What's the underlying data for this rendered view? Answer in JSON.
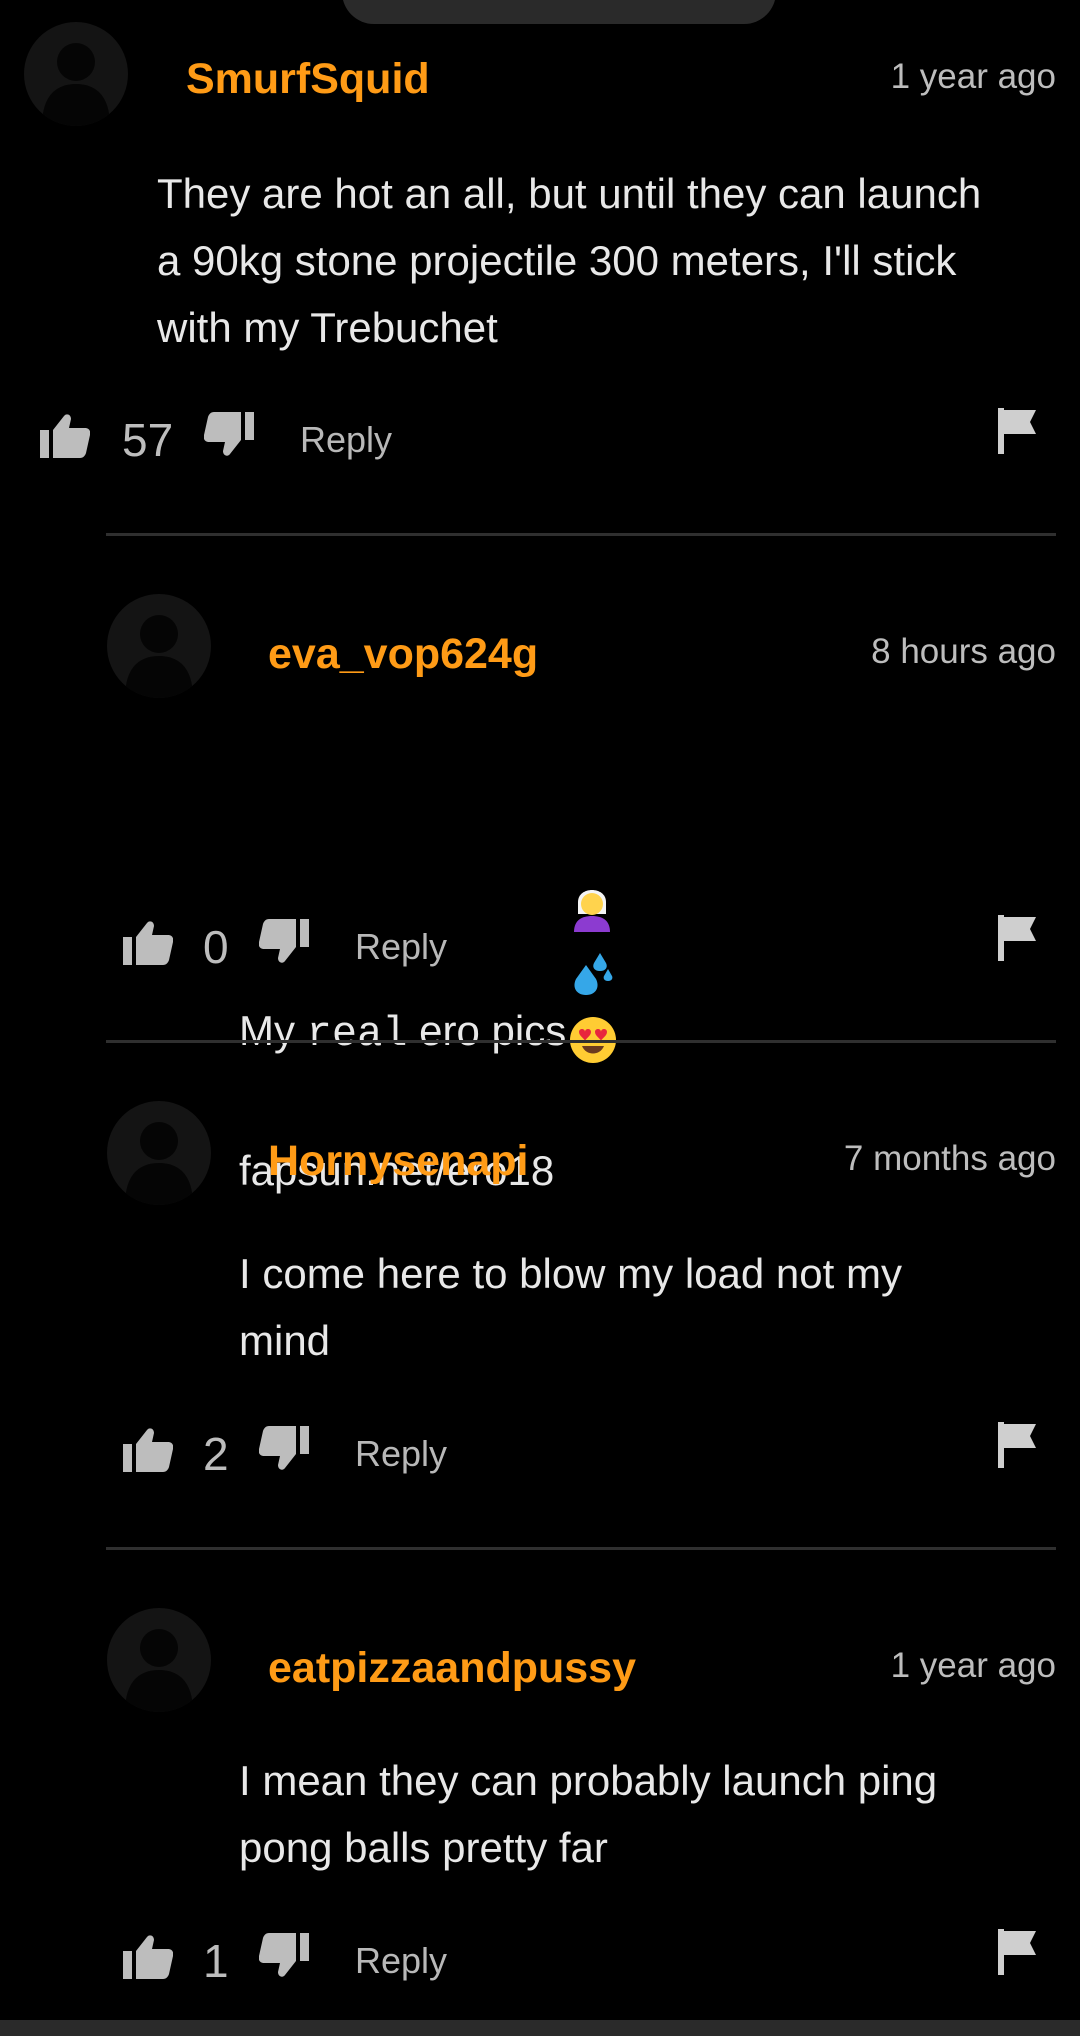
{
  "comments": [
    {
      "username": "SmurfSquid",
      "timestamp": "1 year ago",
      "text": "They are hot an all, but until they can launch\na 90kg stone projectile 300 meters, I'll stick\nwith my Trebuchet",
      "likes": "57",
      "reply_label": "Reply"
    },
    {
      "username": "eva_vop624g",
      "timestamp": "8 hours ago",
      "text_prefix": "My ",
      "text_mono": "real",
      "text_suffix": " ero pics",
      "text_line2": "fapsun.net/ero18",
      "emojis": [
        "woman-white-hair-emoji",
        "sweat-droplets-emoji",
        "heart-eyes-emoji"
      ],
      "likes": "0",
      "reply_label": "Reply"
    },
    {
      "username": "Hornysenapi",
      "timestamp": "7 months ago",
      "text": "I come here to blow my load not my\nmind",
      "likes": "2",
      "reply_label": "Reply"
    },
    {
      "username": "eatpizzaandpussy",
      "timestamp": "1 year ago",
      "text": "I mean they can probably launch ping\npong balls pretty far",
      "likes": "1",
      "reply_label": "Reply"
    }
  ],
  "icons": {
    "like": "thumbs-up-icon",
    "dislike": "thumbs-down-icon",
    "report": "flag-icon",
    "avatar": "default-avatar-icon"
  },
  "colors": {
    "background": "#000000",
    "username": "#ff9b16",
    "text": "#e8e8e8",
    "muted": "#bdbdbd",
    "divider": "#2f2f2f"
  }
}
